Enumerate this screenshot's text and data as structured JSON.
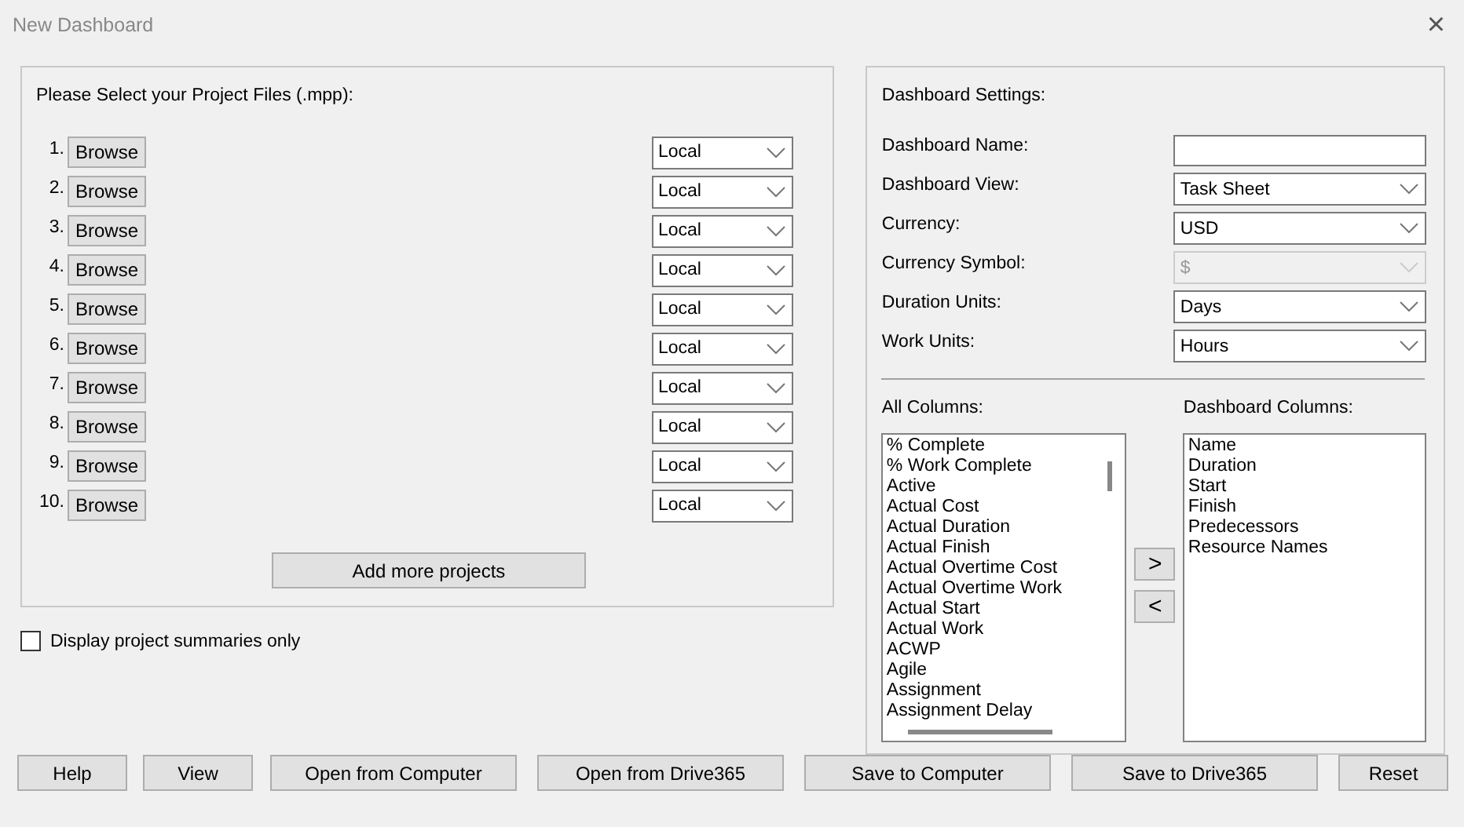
{
  "window": {
    "title": "New Dashboard",
    "close": "×"
  },
  "projects": {
    "heading": "Please Select your Project Files (.mpp):",
    "rows": [
      {
        "number": "1.",
        "button": "Browse",
        "location": "Local"
      },
      {
        "number": "2.",
        "button": "Browse",
        "location": "Local"
      },
      {
        "number": "3.",
        "button": "Browse",
        "location": "Local"
      },
      {
        "number": "4.",
        "button": "Browse",
        "location": "Local"
      },
      {
        "number": "5.",
        "button": "Browse",
        "location": "Local"
      },
      {
        "number": "6.",
        "button": "Browse",
        "location": "Local"
      },
      {
        "number": "7.",
        "button": "Browse",
        "location": "Local"
      },
      {
        "number": "8.",
        "button": "Browse",
        "location": "Local"
      },
      {
        "number": "9.",
        "button": "Browse",
        "location": "Local"
      },
      {
        "number": "10.",
        "button": "Browse",
        "location": "Local"
      }
    ],
    "add_button": "Add more projects"
  },
  "summaries_checkbox": {
    "label": "Display project summaries only",
    "checked": false
  },
  "settings": {
    "heading": "Dashboard Settings:",
    "fields": [
      {
        "label": "Dashboard Name:",
        "kind": "text",
        "disabled": false
      },
      {
        "label": "Dashboard View:",
        "kind": "select",
        "value": "Task Sheet",
        "disabled": false
      },
      {
        "label": "Currency:",
        "kind": "select",
        "value": "USD",
        "disabled": false
      },
      {
        "label": "Currency Symbol:",
        "kind": "select",
        "value": "$",
        "disabled": true
      },
      {
        "label": "Duration Units:",
        "kind": "select",
        "value": "Days",
        "disabled": false
      },
      {
        "label": "Work Units:",
        "kind": "select",
        "value": "Hours",
        "disabled": false
      }
    ],
    "all_columns": {
      "label": "All Columns:",
      "items": [
        "% Complete",
        "% Work Complete",
        "Active",
        "Actual Cost",
        "Actual Duration",
        "Actual Finish",
        "Actual Overtime Cost",
        "Actual Overtime Work",
        "Actual Start",
        "Actual Work",
        "ACWP",
        "Agile",
        "Assignment",
        "Assignment Delay"
      ]
    },
    "move_buttons": [
      ">",
      "<"
    ],
    "dashboard_columns": {
      "label": "Dashboard Columns:",
      "items": [
        "Name",
        "Duration",
        "Start",
        "Finish",
        "Predecessors",
        "Resource Names"
      ]
    }
  },
  "buttons": [
    {
      "label": "Help"
    },
    {
      "label": "View"
    },
    {
      "label": "Open from Computer"
    },
    {
      "label": "Open from Drive365"
    },
    {
      "label": "Save to Computer"
    },
    {
      "label": "Save to Drive365"
    },
    {
      "label": "Reset"
    }
  ]
}
